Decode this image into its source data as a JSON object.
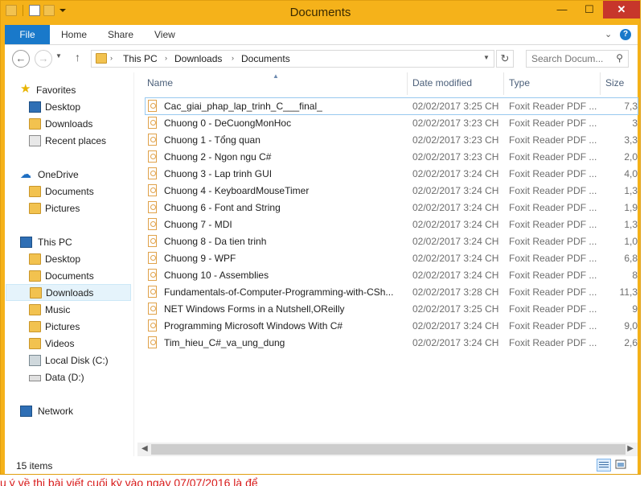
{
  "window": {
    "title": "Documents",
    "controls": {
      "minimize": "—",
      "maximize": "☐",
      "close": "✕"
    }
  },
  "ribbon": {
    "tabs": [
      {
        "label": "File"
      },
      {
        "label": "Home"
      },
      {
        "label": "Share"
      },
      {
        "label": "View"
      }
    ],
    "help": "?"
  },
  "address": {
    "crumbs": [
      "This PC",
      "Downloads",
      "Documents"
    ],
    "search_placeholder": "Search Docum...",
    "search_icon": "magnifier-icon"
  },
  "nav": {
    "favorites": {
      "label": "Favorites",
      "items": [
        {
          "label": "Desktop"
        },
        {
          "label": "Downloads"
        },
        {
          "label": "Recent places"
        }
      ]
    },
    "onedrive": {
      "label": "OneDrive",
      "items": [
        {
          "label": "Documents"
        },
        {
          "label": "Pictures"
        }
      ]
    },
    "thispc": {
      "label": "This PC",
      "items": [
        {
          "label": "Desktop"
        },
        {
          "label": "Documents"
        },
        {
          "label": "Downloads"
        },
        {
          "label": "Music"
        },
        {
          "label": "Pictures"
        },
        {
          "label": "Videos"
        },
        {
          "label": "Local Disk (C:)"
        },
        {
          "label": "Data (D:)"
        }
      ]
    },
    "network": {
      "label": "Network"
    }
  },
  "columns": {
    "name": "Name",
    "date": "Date modified",
    "type": "Type",
    "size": "Size"
  },
  "files": [
    {
      "name": "Cac_giai_phap_lap_trinh_C___final_",
      "date": "02/02/2017 3:25 CH",
      "type": "Foxit Reader PDF ...",
      "size": "7,3"
    },
    {
      "name": "Chuong 0 - DeCuongMonHoc",
      "date": "02/02/2017 3:23 CH",
      "type": "Foxit Reader PDF ...",
      "size": "3"
    },
    {
      "name": "Chuong 1 - Tổng quan",
      "date": "02/02/2017 3:23 CH",
      "type": "Foxit Reader PDF ...",
      "size": "3,3"
    },
    {
      "name": "Chuong 2 - Ngon ngu C#",
      "date": "02/02/2017 3:23 CH",
      "type": "Foxit Reader PDF ...",
      "size": "2,0"
    },
    {
      "name": "Chuong 3 - Lap trinh GUI",
      "date": "02/02/2017 3:24 CH",
      "type": "Foxit Reader PDF ...",
      "size": "4,0"
    },
    {
      "name": "Chuong 4 - KeyboardMouseTimer",
      "date": "02/02/2017 3:24 CH",
      "type": "Foxit Reader PDF ...",
      "size": "1,3"
    },
    {
      "name": "Chuong 6 - Font and String",
      "date": "02/02/2017 3:24 CH",
      "type": "Foxit Reader PDF ...",
      "size": "1,9"
    },
    {
      "name": "Chuong 7 - MDI",
      "date": "02/02/2017 3:24 CH",
      "type": "Foxit Reader PDF ...",
      "size": "1,3"
    },
    {
      "name": "Chuong 8 - Da tien trinh",
      "date": "02/02/2017 3:24 CH",
      "type": "Foxit Reader PDF ...",
      "size": "1,0"
    },
    {
      "name": "Chuong 9 - WPF",
      "date": "02/02/2017 3:24 CH",
      "type": "Foxit Reader PDF ...",
      "size": "6,8"
    },
    {
      "name": "Chuong 10 - Assemblies",
      "date": "02/02/2017 3:24 CH",
      "type": "Foxit Reader PDF ...",
      "size": "8"
    },
    {
      "name": "Fundamentals-of-Computer-Programming-with-CSh...",
      "date": "02/02/2017 3:28 CH",
      "type": "Foxit Reader PDF ...",
      "size": "11,3"
    },
    {
      "name": "NET Windows Forms in a Nutshell,OReilly",
      "date": "02/02/2017 3:25 CH",
      "type": "Foxit Reader PDF ...",
      "size": "9"
    },
    {
      "name": "Programming Microsoft Windows With C#",
      "date": "02/02/2017 3:24 CH",
      "type": "Foxit Reader PDF ...",
      "size": "9,0"
    },
    {
      "name": "Tim_hieu_C#_va_ung_dung",
      "date": "02/02/2017 3:24 CH",
      "type": "Foxit Reader PDF ...",
      "size": "2,6"
    }
  ],
  "status": {
    "count": "15 items"
  },
  "background_text": "u ý về thi bài viết cuối kỳ vào ngày 07/07/2016 là để",
  "colors": {
    "accent": "#1979ca",
    "title_bar": "#f5b21a",
    "close": "#c7362b",
    "selection": "#e5f3fb"
  }
}
